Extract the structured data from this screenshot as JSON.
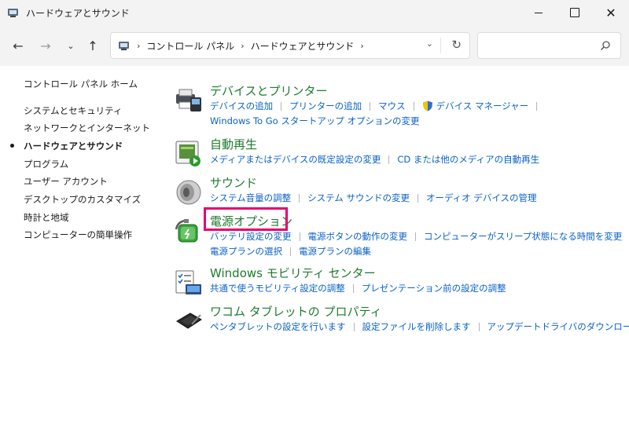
{
  "window": {
    "title": "ハードウェアとサウンド",
    "controls": {
      "minimize": "—",
      "maximize": "☐",
      "close": "✕"
    }
  },
  "nav": {
    "back": "←",
    "forward": "→",
    "recent": "⌄",
    "up": "↑",
    "breadcrumbs": [
      "コントロール パネル",
      "ハードウェアとサウンド"
    ],
    "crumb_sep": "›",
    "dropdown": "⌄",
    "refresh": "↻",
    "search_placeholder": ""
  },
  "sidebar": {
    "items": [
      {
        "label": "コントロール パネル ホーム",
        "current": false
      },
      {
        "label": "システムとセキュリティ",
        "current": false
      },
      {
        "label": "ネットワークとインターネット",
        "current": false
      },
      {
        "label": "ハードウェアとサウンド",
        "current": true
      },
      {
        "label": "プログラム",
        "current": false
      },
      {
        "label": "ユーザー アカウント",
        "current": false
      },
      {
        "label": "デスクトップのカスタマイズ",
        "current": false
      },
      {
        "label": "時計と地域",
        "current": false
      },
      {
        "label": "コンピューターの簡単操作",
        "current": false
      }
    ]
  },
  "categories": [
    {
      "title": "デバイスとプリンター",
      "icon": "printer-icon",
      "lines": [
        [
          "デバイスの追加",
          "プリンターの追加",
          "マウス",
          "デバイス マネージャー"
        ],
        [
          "Windows To Go スタートアップ オプションの変更"
        ]
      ]
    },
    {
      "title": "自動再生",
      "icon": "autoplay-icon",
      "lines": [
        [
          "メディアまたはデバイスの既定設定の変更",
          "CD または他のメディアの自動再生"
        ]
      ]
    },
    {
      "title": "サウンド",
      "icon": "speaker-icon",
      "lines": [
        [
          "システム音量の調整",
          "システム サウンドの変更",
          "オーディオ デバイスの管理"
        ]
      ]
    },
    {
      "title": "電源オプション",
      "icon": "power-options-icon",
      "lines": [
        [
          "バッテリ設定の変更",
          "電源ボタンの動作の変更",
          "コンピューターがスリープ状態になる時間を変更"
        ],
        [
          "電源プランの選択",
          "電源プランの編集"
        ]
      ]
    },
    {
      "title": "Windows モビリティ センター",
      "icon": "mobility-center-icon",
      "lines": [
        [
          "共通で使うモビリティ設定の調整",
          "プレゼンテーション前の設定の調整"
        ]
      ]
    },
    {
      "title": "ワコム タブレットの プロパティ",
      "icon": "tablet-icon",
      "lines": [
        [
          "ペンタブレットの設定を行います",
          "設定ファイルを削除します",
          "アップデートドライバのダウンロード"
        ]
      ]
    }
  ],
  "colors": {
    "category_title": "#1e7b2e",
    "link": "#0a62c9",
    "highlight_box": "#e6006e"
  }
}
